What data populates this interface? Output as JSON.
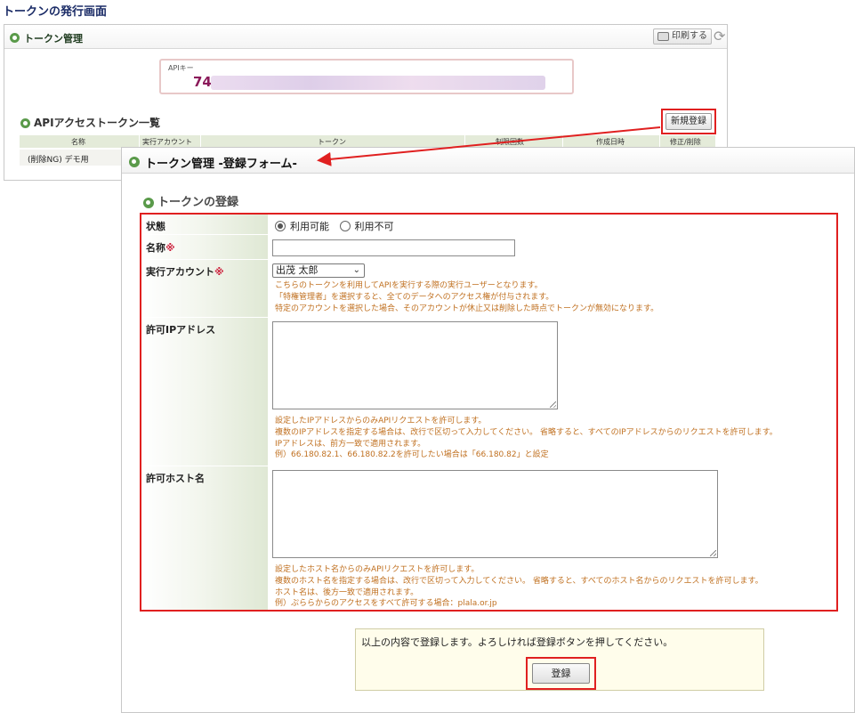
{
  "page": {
    "title": "トークンの発行画面"
  },
  "back": {
    "header_title": "トークン管理",
    "print_label": "印刷する",
    "apikey_label": "APIキー",
    "apikey_prefix": "74",
    "list_title": "APIアクセストークン一覧",
    "new_button": "新規登録",
    "columns": [
      "名称",
      "実行アカウント",
      "トークン",
      "制限回数",
      "作成日時",
      "修正/削除"
    ],
    "rows": [
      {
        "name": "(削除NG) デモ用"
      }
    ]
  },
  "form": {
    "window_title": "トークン管理 -登録フォーム-",
    "section_title": "トークンの登録",
    "status": {
      "label": "状態",
      "options": [
        "利用可能",
        "利用不可"
      ],
      "selected": "利用可能"
    },
    "name": {
      "label": "名称",
      "required_mark": "※",
      "value": ""
    },
    "account": {
      "label": "実行アカウント",
      "required_mark": "※",
      "value": "出茂 太郎",
      "help": [
        "こちらのトークンを利用してAPIを実行する際の実行ユーザーとなります。",
        "「特権管理者」を選択すると、全てのデータへのアクセス権が付与されます。",
        "特定のアカウントを選択した場合、そのアカウントが休止又は削除した時点でトークンが無効になります。"
      ]
    },
    "ip": {
      "label": "許可IPアドレス",
      "value": "",
      "help": [
        "設定したIPアドレスからのみAPIリクエストを許可します。",
        "複数のIPアドレスを指定する場合は、改行で区切って入力してください。 省略すると、すべてのIPアドレスからのリクエストを許可します。",
        "IPアドレスは、前方一致で適用されます。",
        "例）66.180.82.1、66.180.82.2を許可したい場合は「66.180.82」と設定"
      ]
    },
    "host": {
      "label": "許可ホスト名",
      "value": "",
      "help": [
        "設定したホスト名からのみAPIリクエストを許可します。",
        "複数のホスト名を指定する場合は、改行で区切って入力してください。 省略すると、すべてのホスト名からのリクエストを許可します。",
        "ホスト名は、後方一致で適用されます。",
        "例）ぷららからのアクセスをすべて許可する場合：plala.or.jp"
      ]
    },
    "confirm_text": "以上の内容で登録します。よろしければ登録ボタンを押してください。",
    "submit_label": "登録"
  },
  "colors": {
    "highlight": "#e02020",
    "help_text": "#c07020",
    "accent_green": "#5a9a4a"
  }
}
